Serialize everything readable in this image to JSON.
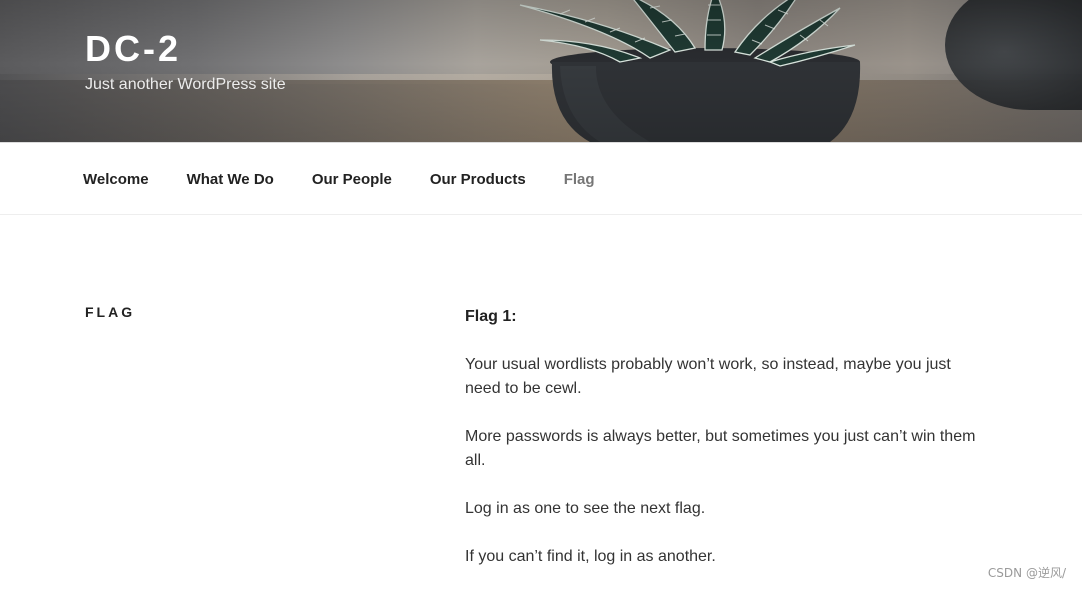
{
  "header": {
    "site_title": "DC-2",
    "site_description": "Just another WordPress site"
  },
  "nav": {
    "items": [
      {
        "label": "Welcome",
        "current": false
      },
      {
        "label": "What We Do",
        "current": false
      },
      {
        "label": "Our People",
        "current": false
      },
      {
        "label": "Our Products",
        "current": false
      },
      {
        "label": "Flag",
        "current": true
      }
    ]
  },
  "page": {
    "title": "FLAG",
    "paragraphs": [
      "Flag 1:",
      "Your usual wordlists probably won’t work, so instead, maybe you just need to be cewl.",
      "More passwords is always better, but sometimes you just can’t win them all.",
      "Log in as one to see the next flag.",
      "If you can’t find it, log in as another."
    ]
  },
  "watermark": "CSDN @逆风/",
  "colors": {
    "nav_text": "#222222",
    "nav_current": "#767676",
    "body_text": "#333333"
  }
}
